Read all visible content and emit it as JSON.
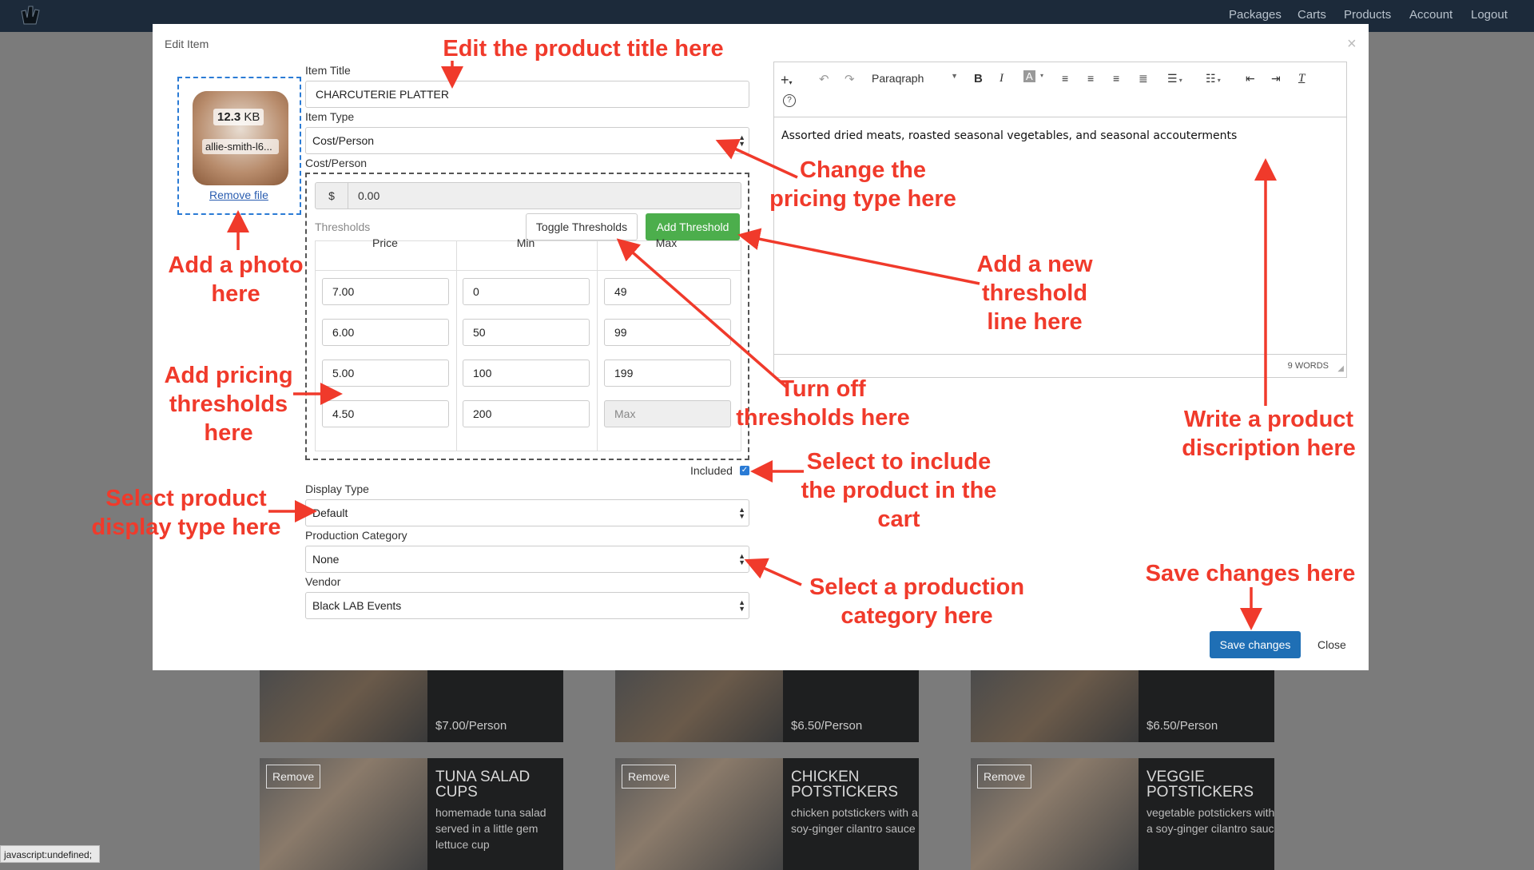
{
  "nav": {
    "items": [
      "Packages",
      "Carts",
      "Products",
      "Account",
      "Logout"
    ]
  },
  "background": {
    "top_cards": [
      {
        "price": "$7.00/Person"
      },
      {
        "price": "$6.50/Person"
      },
      {
        "price": "$6.50/Person"
      }
    ],
    "bottom_cards": [
      {
        "remove": "Remove",
        "title": "TUNA SALAD CUPS",
        "desc": "homemade tuna salad served in a little gem lettuce cup"
      },
      {
        "remove": "Remove",
        "title": "CHICKEN POTSTICKERS",
        "desc": "chicken potstickers with a soy-ginger cilantro sauce"
      },
      {
        "remove": "Remove",
        "title": "VEGGIE POTSTICKERS",
        "desc": "vegetable potstickers with a soy-ginger cilantro sauce"
      }
    ]
  },
  "status_bar": "javascript:undefined;",
  "modal": {
    "title": "Edit Item",
    "close_x": "×",
    "photo": {
      "size_value": "12.3",
      "size_unit": "KB",
      "filename": "allie-smith-l6...",
      "remove": "Remove file"
    },
    "item_title": {
      "label": "Item Title",
      "value": "CHARCUTERIE PLATTER"
    },
    "item_type": {
      "label": "Item Type",
      "value": "Cost/Person"
    },
    "cost": {
      "label": "Cost/Person",
      "currency": "$",
      "value": "0.00"
    },
    "thresholds": {
      "label": "Thresholds",
      "toggle": "Toggle Thresholds",
      "add": "Add Threshold",
      "headers": [
        "Price",
        "Min",
        "Max"
      ],
      "rows": [
        [
          "7.00",
          "0",
          "49"
        ],
        [
          "6.00",
          "50",
          "99"
        ],
        [
          "5.00",
          "100",
          "199"
        ],
        [
          "4.50",
          "200",
          ""
        ]
      ],
      "max_placeholder": "Max"
    },
    "included": {
      "label": "Included",
      "checked": true
    },
    "display_type": {
      "label": "Display Type",
      "value": "Default"
    },
    "production_category": {
      "label": "Production Category",
      "value": "None"
    },
    "vendor": {
      "label": "Vendor",
      "value": "Black LAB Events"
    },
    "editor": {
      "block_format": "Paraqraph",
      "content": "Assorted dried meats, roasted seasonal vegetables, and seasonal accouterments",
      "word_count": "9 WORDS"
    },
    "save": "Save changes",
    "close": "Close"
  },
  "annotations": {
    "title": "Edit the product title here",
    "pricing_type": "Change the pricing type here",
    "photo": "Add a photo here",
    "new_threshold": "Add a new threshold line here",
    "pricing_thresholds": "Add pricing thresholds here",
    "turn_off": "Turn off thresholds here",
    "description": "Write a product discription here",
    "include": "Select to include the product in the cart",
    "display_type": "Select product display type here",
    "production_category": "Select a production category here",
    "save": "Save changes here"
  },
  "colors": {
    "annotation": "#f03a2b",
    "save_button": "#1f6fb5",
    "add_threshold": "#4cae4c",
    "nav_bg": "#1c2a3a"
  }
}
